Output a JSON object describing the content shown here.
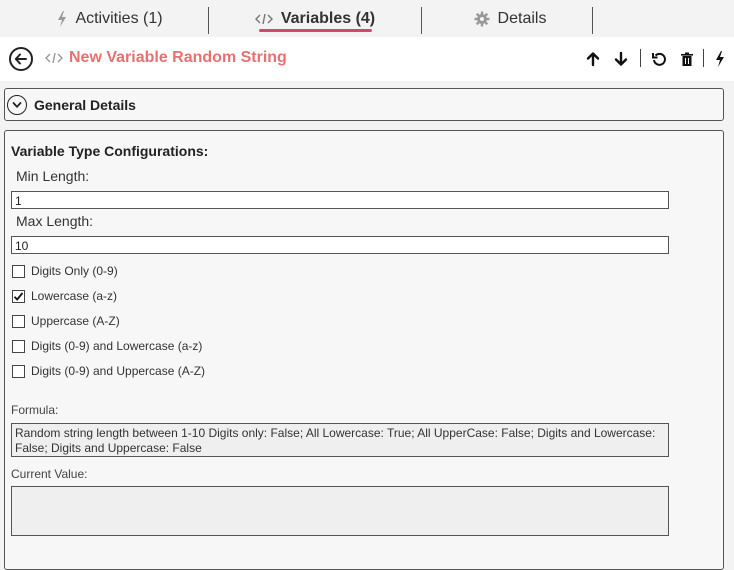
{
  "tabs": [
    {
      "label": "Activities (1)",
      "icon": "lightning-icon"
    },
    {
      "label": "Variables (4)",
      "icon": "code-icon"
    },
    {
      "label": "Details",
      "icon": "gear-icon"
    }
  ],
  "header": {
    "title": "New Variable Random String",
    "title_color": "#e87070",
    "tab_accent": "#d5476a"
  },
  "general": {
    "label": "General Details"
  },
  "config": {
    "title": "Variable Type Configurations:",
    "min_length": {
      "label": "Min Length:",
      "value": "1"
    },
    "max_length": {
      "label": "Max Length:",
      "value": "10"
    },
    "options": [
      {
        "label": "Digits Only (0-9)",
        "checked": false
      },
      {
        "label": "Lowercase (a-z)",
        "checked": true
      },
      {
        "label": "Uppercase (A-Z)",
        "checked": false
      },
      {
        "label": "Digits (0-9) and Lowercase (a-z)",
        "checked": false
      },
      {
        "label": "Digits (0-9) and Uppercase (A-Z)",
        "checked": false
      }
    ],
    "formula_label": "Formula:",
    "formula_text": "Random string length between 1-10 Digits only: False; All Lowercase: True; All UpperCase: False; Digits and Lowercase: False; Digits and Uppercase: False",
    "current_value_label": "Current Value:",
    "current_value": ""
  }
}
